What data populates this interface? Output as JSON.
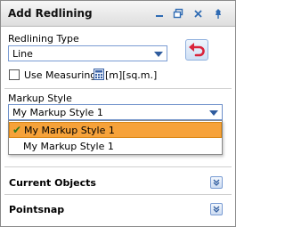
{
  "window": {
    "title": "Add Redlining",
    "controls": [
      "minimize-icon",
      "restore-icon",
      "close-icon",
      "pin-icon"
    ]
  },
  "redlining_type": {
    "label": "Redlining Type",
    "value": "Line"
  },
  "undo_icon": "undo-icon",
  "measuring": {
    "checkbox_label": "Use Measuring",
    "checked": false,
    "units": "[m][sq.m.]"
  },
  "markup_style": {
    "label": "Markup Style",
    "value": "My Markup Style 1",
    "options": [
      {
        "label": "My Markup Style 1",
        "selected": true
      },
      {
        "label": "My Markup Style 1",
        "selected": false
      }
    ]
  },
  "sections": [
    {
      "title": "Current Objects"
    },
    {
      "title": "Pointsnap"
    }
  ],
  "colors": {
    "accent": "#2f6bb3",
    "selection": "#f6a23a",
    "undo": "#d9233b"
  }
}
